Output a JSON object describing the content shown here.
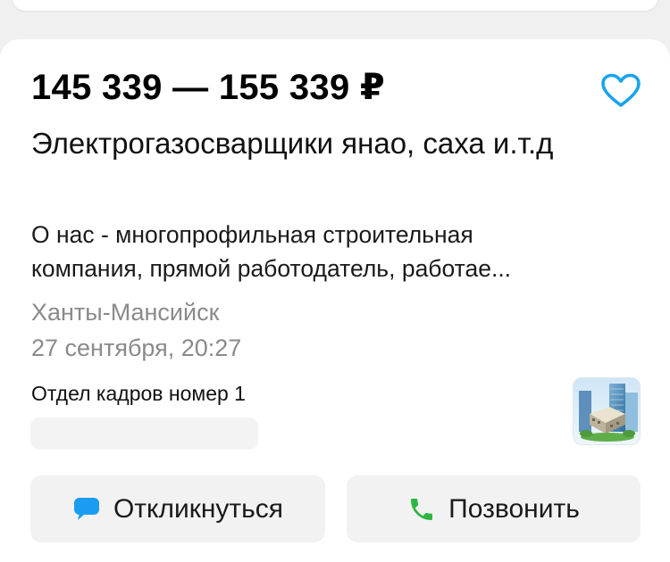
{
  "vacancy": {
    "salary": "145 339 — 155 339 ₽",
    "title": "Электрогазосварщики янао, саха и.т.д",
    "snippet_lines": [
      "О нас - многопрофильная строительная",
      "компания, прямой работодатель, работае..."
    ],
    "location": "Ханты-Мансийск",
    "date": "27 сентября, 20:27",
    "company": "Отдел кадров номер 1"
  },
  "actions": {
    "respond_label": "Откликнуться",
    "call_label": "Позвонить"
  },
  "icons": {
    "favorite": "heart-outline-icon",
    "respond": "chat-bubble-icon",
    "call": "phone-icon",
    "logo": "buildings-logo"
  },
  "colors": {
    "favorite": "#1aa3ee",
    "respond_icon": "#1a9cf0",
    "call_icon": "#2fb543",
    "secondary_text": "#8a8a8a",
    "button_bg": "#f2f2f2"
  }
}
